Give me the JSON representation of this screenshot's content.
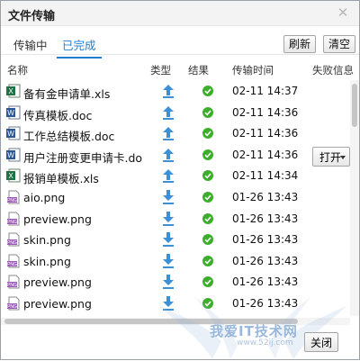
{
  "window": {
    "title": "文件传输"
  },
  "tabs": [
    {
      "label": "传输中",
      "active": false
    },
    {
      "label": "已完成",
      "active": true
    }
  ],
  "toolbar": {
    "refresh_label": "刷新",
    "clear_label": "清空"
  },
  "columns": {
    "name": "名称",
    "type": "类型",
    "result": "结果",
    "time": "传输时间",
    "fail": "失败信息"
  },
  "files": [
    {
      "name": "备有金申请单.xls",
      "icon": "excel-icon",
      "type": "upload",
      "result": "success",
      "time": "02-11 14:37"
    },
    {
      "name": "传真模板.doc",
      "icon": "word-icon",
      "type": "upload",
      "result": "success",
      "time": "02-11 14:36"
    },
    {
      "name": "工作总结模板.doc",
      "icon": "word-icon",
      "type": "upload",
      "result": "success",
      "time": "02-11 14:36"
    },
    {
      "name": "用户注册变更申请卡.do",
      "icon": "word-icon",
      "type": "upload",
      "result": "success",
      "time": "02-11 14:36"
    },
    {
      "name": "报销单模板.xls",
      "icon": "excel-icon",
      "type": "upload",
      "result": "success",
      "time": "02-11 14:34"
    },
    {
      "name": "aio.png",
      "icon": "image-icon",
      "type": "download",
      "result": "success",
      "time": "01-26 13:43"
    },
    {
      "name": "preview.png",
      "icon": "image-icon",
      "type": "download",
      "result": "success",
      "time": "01-26 13:43"
    },
    {
      "name": "skin.png",
      "icon": "image-icon",
      "type": "download",
      "result": "success",
      "time": "01-26 13:43"
    },
    {
      "name": "skin.png",
      "icon": "image-icon",
      "type": "download",
      "result": "success",
      "time": "01-26 13:43"
    },
    {
      "name": "preview.png",
      "icon": "image-icon",
      "type": "download",
      "result": "success",
      "time": "01-26 13:43"
    },
    {
      "name": "preview.png",
      "icon": "image-icon",
      "type": "download",
      "result": "success",
      "time": "01-26 13:43"
    }
  ],
  "actions": {
    "open_label": "打开",
    "close_label": "关闭"
  },
  "watermark": {
    "text": "我爱IT技术网",
    "sub": "www.52ij.com"
  },
  "colors": {
    "accent": "#1f7ed0",
    "success": "#3cae2c",
    "excel": "#207245",
    "word": "#2b5797",
    "image": "#9b59b6"
  }
}
